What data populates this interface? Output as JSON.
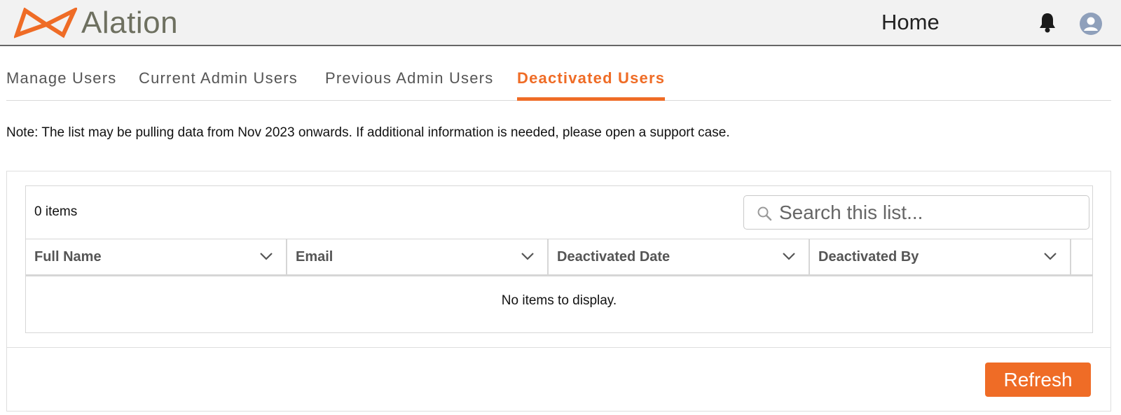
{
  "app": {
    "brand": "Alation",
    "page_title": "Home",
    "accent_color": "#ef6c26",
    "icons": [
      "bell-icon",
      "user-avatar-icon",
      "search-icon",
      "chevron-down-icon"
    ]
  },
  "tabs": [
    {
      "label": "Manage Users",
      "active": false
    },
    {
      "label": "Current Admin Users",
      "active": false
    },
    {
      "label": "Previous Admin Users",
      "active": false
    },
    {
      "label": "Deactivated Users",
      "active": true
    }
  ],
  "note": "Note: The list may be pulling data from Nov 2023 onwards. If additional information is needed, please open a support case.",
  "list": {
    "count_label": "0 items",
    "search_placeholder": "Search this list...",
    "columns": [
      "Full Name",
      "Email",
      "Deactivated Date",
      "Deactivated By"
    ],
    "empty_message": "No items to display."
  },
  "footer": {
    "refresh_label": "Refresh"
  }
}
